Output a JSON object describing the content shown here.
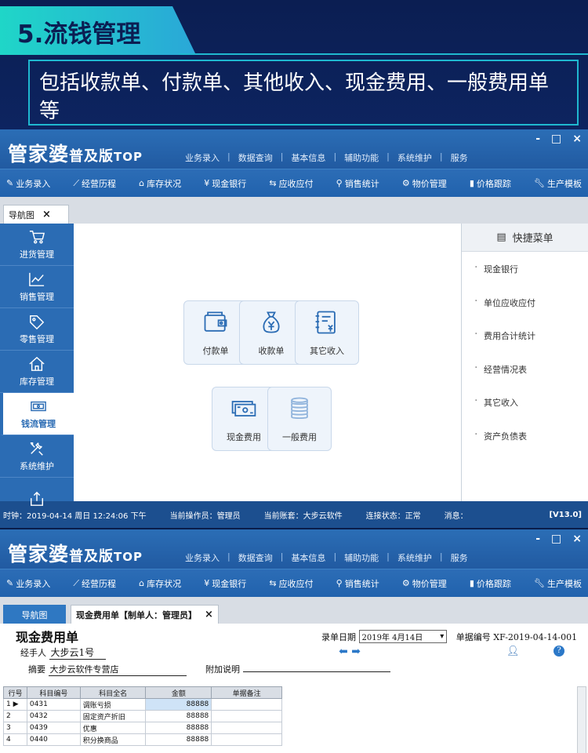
{
  "banner": {
    "section_title": "5.流钱管理",
    "description": "包括收款单、付款单、其他收入、现金费用、一般费用单等"
  },
  "app": {
    "logo_main": "管家婆",
    "logo_sub": "普及版",
    "logo_top": "TOP",
    "main_menu": [
      "业务录入",
      "数据查询",
      "基本信息",
      "辅助功能",
      "系统维护",
      "服务"
    ],
    "window_controls": [
      "-",
      "□",
      "×"
    ],
    "toolbar": [
      {
        "label": "业务录入",
        "icon": "entry-icon"
      },
      {
        "label": "经营历程",
        "icon": "chart-icon"
      },
      {
        "label": "库存状况",
        "icon": "home-icon"
      },
      {
        "label": "现金银行",
        "icon": "yen-icon"
      },
      {
        "label": "应收应付",
        "icon": "exchange-icon"
      },
      {
        "label": "销售统计",
        "icon": "search-icon"
      },
      {
        "label": "物价管理",
        "icon": "gear-icon"
      },
      {
        "label": "价格跟踪",
        "icon": "bar-chart-icon"
      },
      {
        "label": "生产模板",
        "icon": "wrench-icon"
      }
    ]
  },
  "screen1": {
    "tab": "导航图",
    "nav": [
      {
        "label": "进货管理",
        "icon": "cart-icon",
        "active": false
      },
      {
        "label": "销售管理",
        "icon": "trend-icon",
        "active": false
      },
      {
        "label": "零售管理",
        "icon": "tag-icon",
        "active": false
      },
      {
        "label": "库存管理",
        "icon": "house-icon",
        "active": false
      },
      {
        "label": "钱流管理",
        "icon": "cash-icon",
        "active": true
      },
      {
        "label": "系统维护",
        "icon": "tools-icon",
        "active": false
      },
      {
        "label": "",
        "icon": "export-icon",
        "active": false
      }
    ],
    "tiles": [
      "付款单",
      "收款单",
      "其它收入",
      "现金费用",
      "一般费用"
    ],
    "quick_menu_title": "快捷菜单",
    "quick_menu": [
      "现金银行",
      "单位应收应付",
      "费用合计统计",
      "经营情况表",
      "其它收入",
      "资产负债表"
    ],
    "status": {
      "time": "时钟：2019-04-14 周日 12:24:06 下午",
      "operator": "当前操作员：管理员",
      "account": "当前账套：大步云软件",
      "connection": "连接状态：正常",
      "message": "消息：",
      "version": "[V13.0]"
    }
  },
  "screen2": {
    "tab_nav": "导航图",
    "tab_doc": "现金费用单【制单人：管理员】",
    "form_title": "现金费用单",
    "date_label": "录单日期",
    "date_value": "2019年 4月14日",
    "docno_label": "单据编号",
    "docno_value": "XF-2019-04-14-001",
    "handler_label": "经手人",
    "handler_value": "大步云1号",
    "summary_label": "摘要",
    "summary_value": "大步云软件专营店",
    "note_label": "附加说明",
    "note_value": "",
    "columns": [
      "行号",
      "科目编号",
      "科目全名",
      "金额",
      "单据备注"
    ],
    "rows": [
      {
        "no": "1",
        "code": "0431",
        "name": "调账亏损",
        "amount": "88888",
        "remark": ""
      },
      {
        "no": "2",
        "code": "0432",
        "name": "固定资产折旧",
        "amount": "88888",
        "remark": ""
      },
      {
        "no": "3",
        "code": "0439",
        "name": "优惠",
        "amount": "88888",
        "remark": ""
      },
      {
        "no": "4",
        "code": "0440",
        "name": "积分换商品",
        "amount": "88888",
        "remark": ""
      }
    ]
  }
}
